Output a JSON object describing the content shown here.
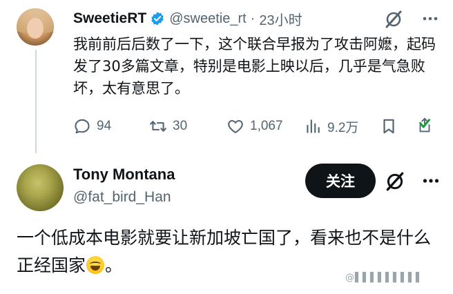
{
  "tweet": {
    "author_name": "SweetieRT",
    "author_handle": "@sweetie_rt",
    "separator": "·",
    "time": "23小时",
    "text": "我前前后后数了一下，这个联合早报为了攻击阿嬷，起码发了30多篇文章，特别是电影上映以后，几乎是气急败坏，太有意思了。",
    "stats": {
      "replies": "94",
      "retweets": "30",
      "likes": "1,067",
      "views": "9.2万"
    }
  },
  "reply": {
    "author_name": "Tony Montana",
    "author_handle": "@fat_bird_Han",
    "follow_label": "关注",
    "text_part1": "一个低成本电影就要让新加坡亡国了，看来也不是什么正经国家",
    "text_part2": "。"
  },
  "watermark": "@▌▌▌▌▌▌▌▌▌",
  "colors": {
    "verified_blue": "#1d9bf0",
    "text_primary": "#0f1419",
    "text_secondary": "#536471",
    "share_green": "#1a9e3b"
  },
  "icons": {
    "verified": "verified-badge-icon",
    "grok": "grok-icon",
    "more": "more-options-icon",
    "reply": "reply-icon",
    "retweet": "retweet-icon",
    "like": "like-icon",
    "views": "views-icon",
    "bookmark": "bookmark-icon",
    "share": "share-icon",
    "emoji": "tears-of-joy-emoji"
  }
}
